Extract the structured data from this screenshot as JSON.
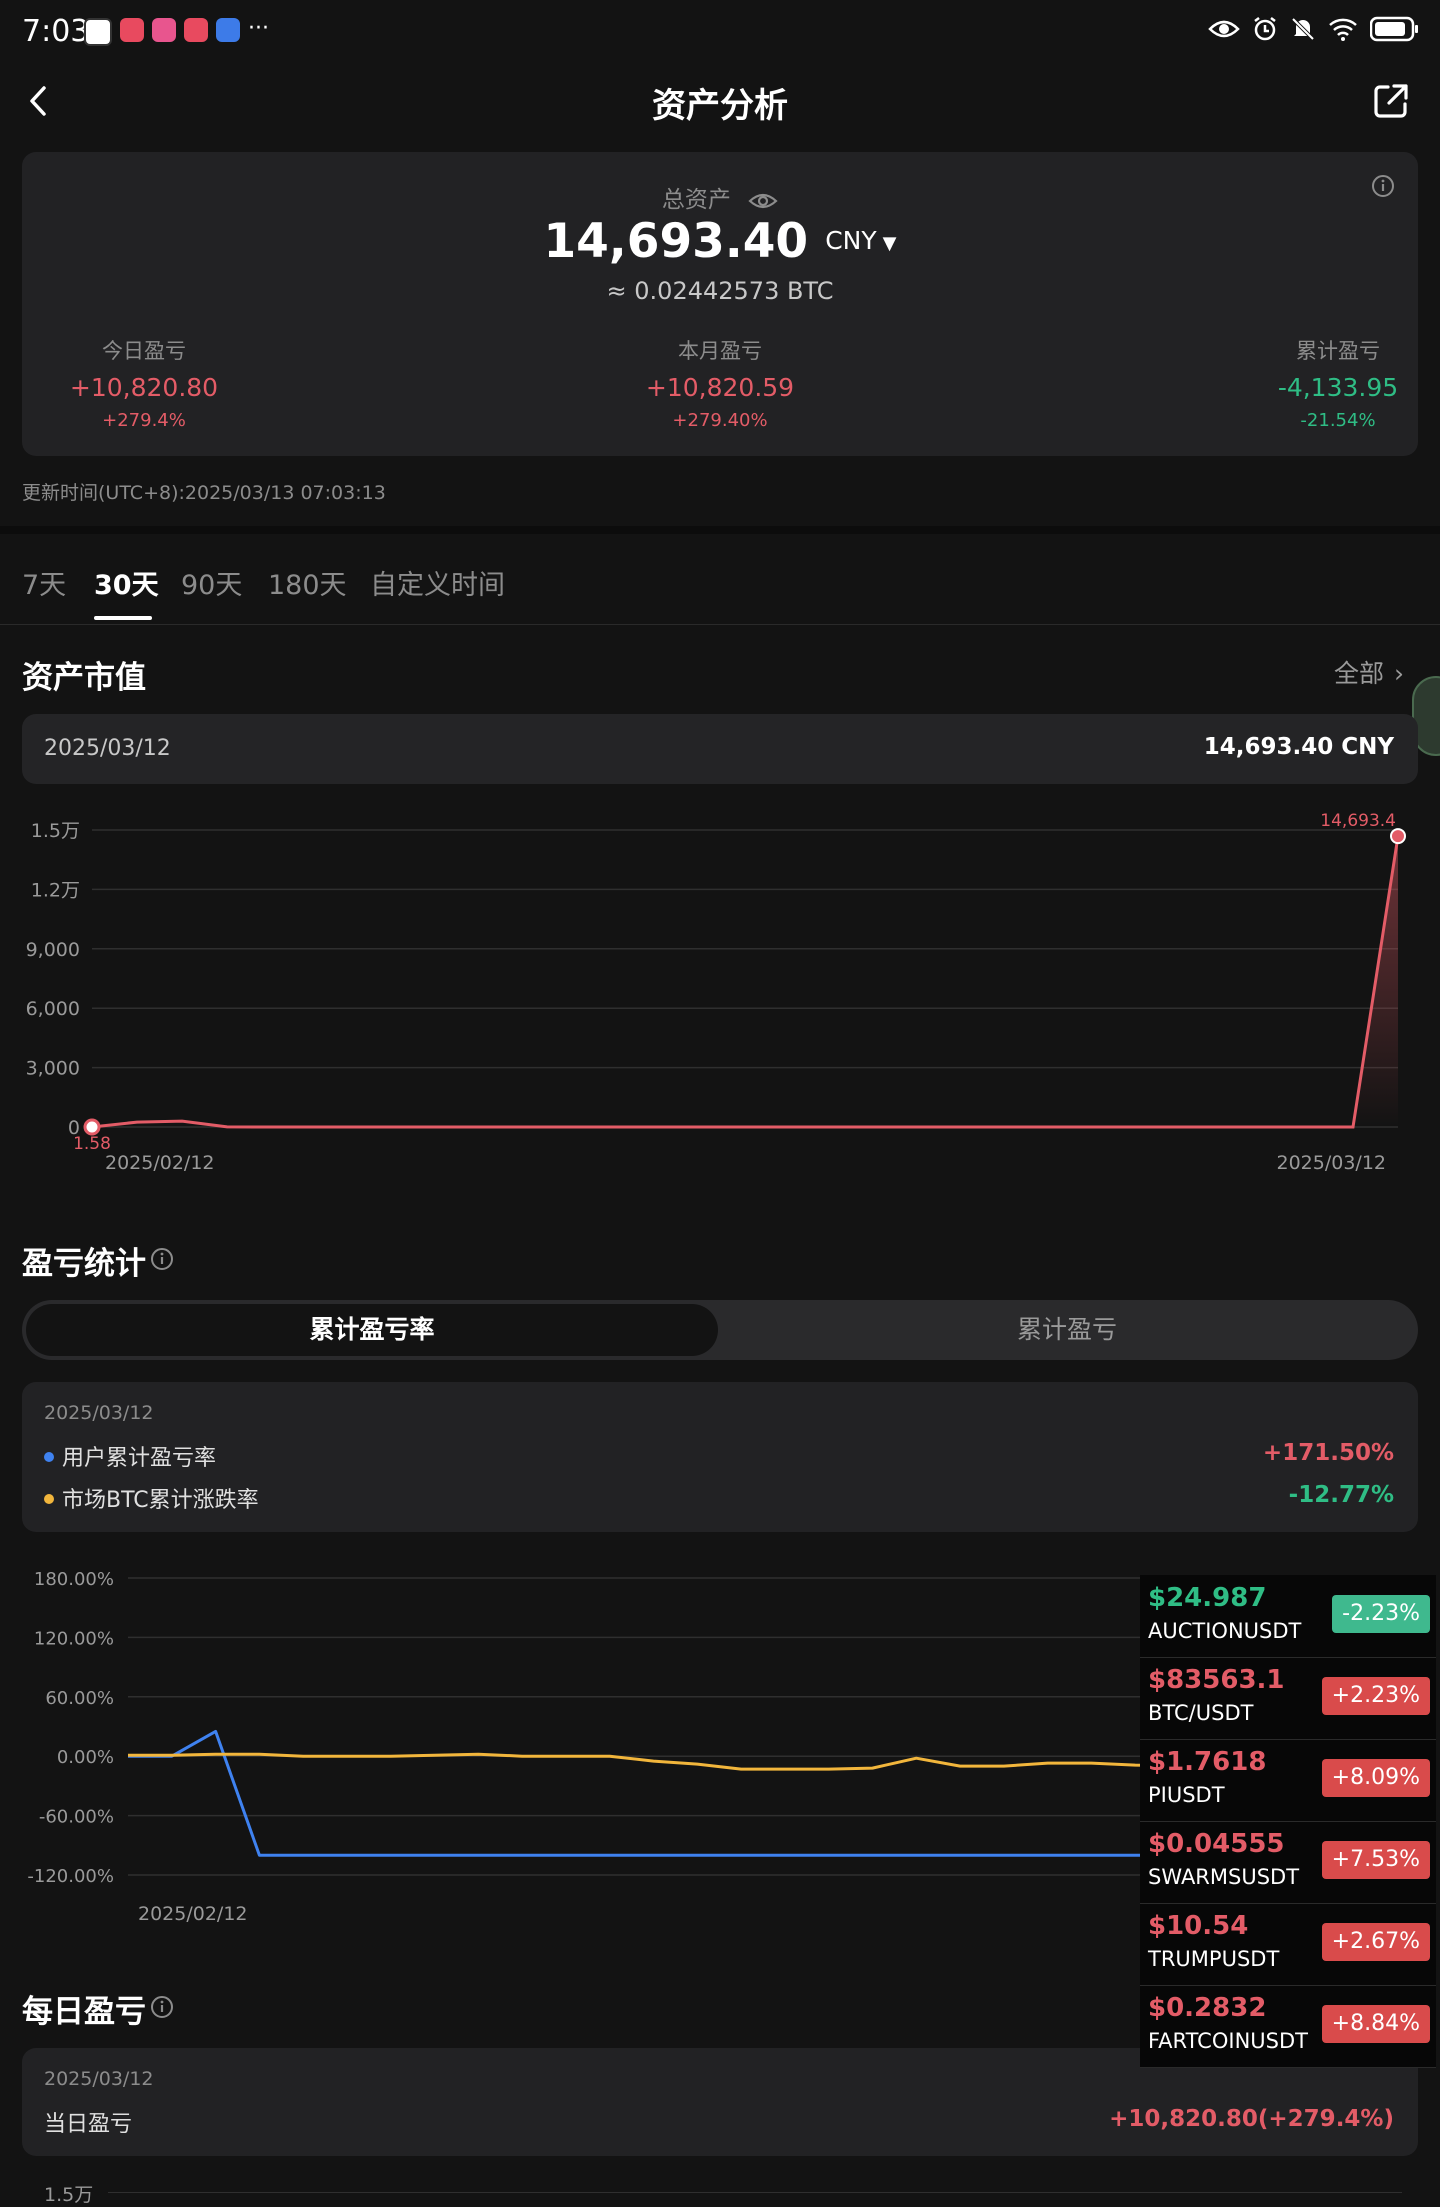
{
  "status_bar": {
    "time": "7:03",
    "more": "···"
  },
  "header": {
    "title": "资产分析"
  },
  "summary": {
    "total_label": "总资产",
    "total_value": "14,693.40",
    "currency": "CNY",
    "btc_equiv": "≈ 0.02442573 BTC",
    "today": {
      "label": "今日盈亏",
      "value": "+10,820.80",
      "pct": "+279.4%"
    },
    "month": {
      "label": "本月盈亏",
      "value": "+10,820.59",
      "pct": "+279.40%"
    },
    "cumulative": {
      "label": "累计盈亏",
      "value": "-4,133.95",
      "pct": "-21.54%"
    }
  },
  "update_time": "更新时间(UTC+8):2025/03/13 07:03:13",
  "tabs": [
    "7天",
    "30天",
    "90天",
    "180天",
    "自定义时间"
  ],
  "asset_value": {
    "title": "资产市值",
    "all_label": "全部",
    "date": "2025/03/12",
    "value": "14,693.40 CNY"
  },
  "chart_data": [
    {
      "type": "area",
      "yticks": [
        "1.5万",
        "1.2万",
        "9,000",
        "6,000",
        "3,000",
        "0"
      ],
      "ylim": [
        0,
        15000
      ],
      "x_start_label": "2025/02/12",
      "x_end_label": "2025/03/12",
      "annotations": {
        "min_label": "1.58",
        "max_label": "14,693.4"
      },
      "values": [
        0,
        250,
        300,
        5,
        2,
        2,
        2,
        2,
        2,
        2,
        2,
        2,
        1.58,
        2,
        2,
        2,
        2,
        2,
        2,
        2,
        2,
        2,
        2,
        2,
        2,
        2,
        2,
        2,
        2,
        14693.4
      ],
      "color": "#e35c67"
    },
    {
      "type": "line",
      "yticks": [
        "180.00%",
        "120.00%",
        "60.00%",
        "0.00%",
        "-60.00%",
        "-120.00%"
      ],
      "ylim": [
        -120,
        180
      ],
      "x_start_label": "2025/02/12",
      "x_end_label": "2025/03/12",
      "series": [
        {
          "name": "用户累计盈亏率",
          "color": "#3f82f0",
          "values": [
            0,
            0,
            25,
            -100,
            -100,
            -100,
            -100,
            -100,
            -100,
            -100,
            -100,
            -100,
            -100,
            -100,
            -100,
            -100,
            -100,
            -100,
            -100,
            -100,
            -100,
            -100,
            -100,
            -100,
            -100,
            -100,
            -100,
            -100,
            -100,
            171.5
          ]
        },
        {
          "name": "市场BTC累计涨跌率",
          "color": "#f2b63c",
          "values": [
            1,
            1,
            2,
            2,
            0,
            0,
            0,
            1,
            2,
            0,
            0,
            0,
            -5,
            -8,
            -13,
            -13,
            -13,
            -12,
            -2,
            -10,
            -10,
            -7,
            -7,
            -9,
            -10,
            -12,
            -13,
            -13,
            -13,
            -12.77
          ]
        }
      ]
    }
  ],
  "pnl_stats": {
    "title": "盈亏统计",
    "seg_active": "累计盈亏率",
    "seg_inactive": "累计盈亏",
    "date": "2025/03/12",
    "user_label": "用户累计盈亏率",
    "user_value": "+171.50%",
    "btc_label": "市场BTC累计涨跌率",
    "btc_value": "-12.77%"
  },
  "daily": {
    "title": "每日盈亏",
    "date": "2025/03/12",
    "label": "当日盈亏",
    "value": "+10,820.80(+279.4%)",
    "ytick": "1.5万"
  },
  "tickers": [
    {
      "price": "$24.987",
      "name": "AUCTIONUSDT",
      "change": "-2.23%",
      "up": false
    },
    {
      "price": "$83563.1",
      "name": "BTC/USDT",
      "change": "+2.23%",
      "up": true
    },
    {
      "price": "$1.7618",
      "name": "PIUSDT",
      "change": "+8.09%",
      "up": true
    },
    {
      "price": "$0.04555",
      "name": "SWARMSUSDT",
      "change": "+7.53%",
      "up": true
    },
    {
      "price": "$10.54",
      "name": "TRUMPUSDT",
      "change": "+2.67%",
      "up": true
    },
    {
      "price": "$0.2832",
      "name": "FARTCOINUSDT",
      "change": "+8.84%",
      "up": true
    }
  ],
  "colors": {
    "red": "#e35c67",
    "green": "#2fbd85",
    "blue": "#3f82f0",
    "yellow": "#f2b63c"
  }
}
